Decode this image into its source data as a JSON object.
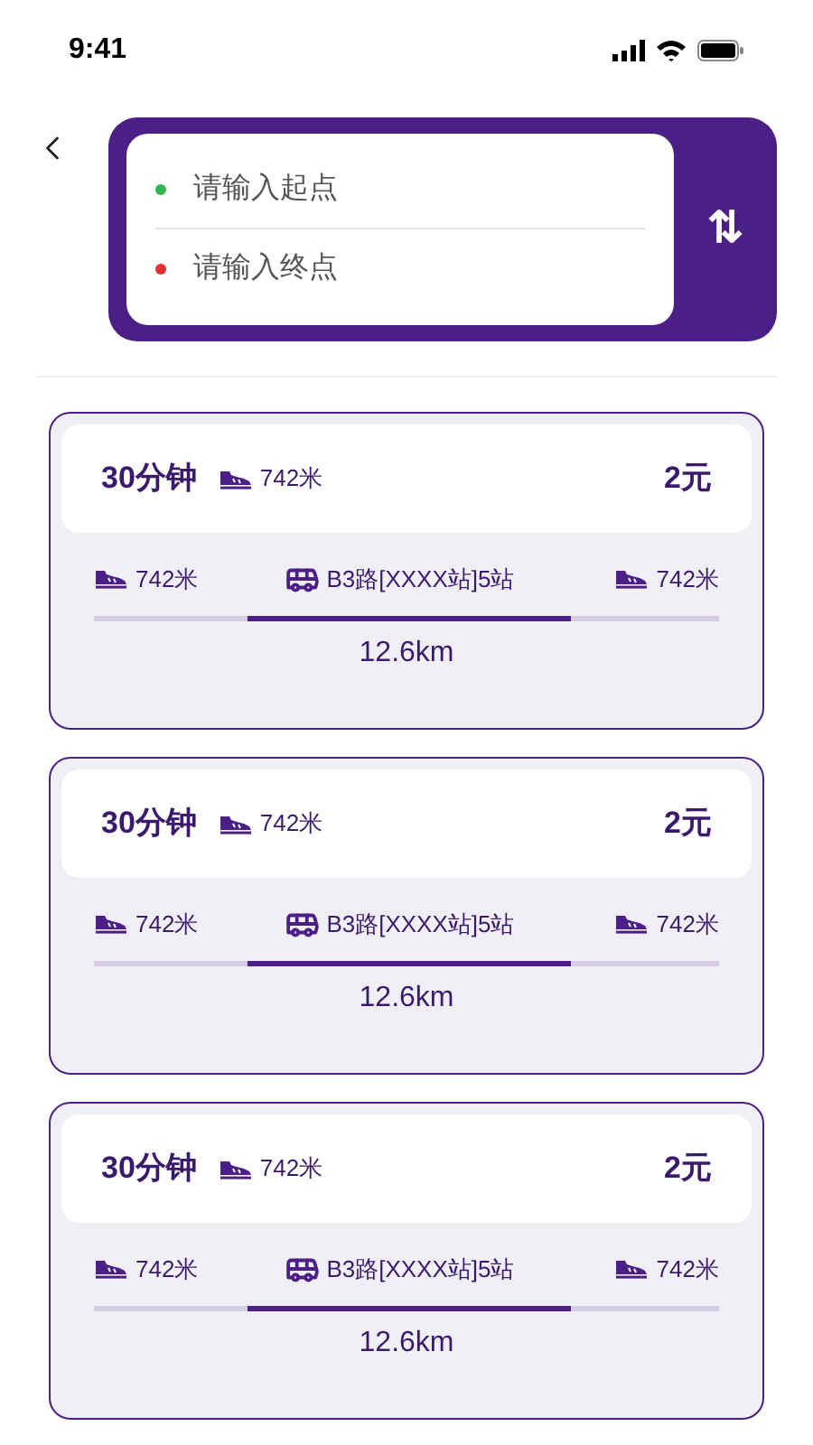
{
  "status_bar": {
    "time": "9:41"
  },
  "search": {
    "start": {
      "placeholder": "请输入起点",
      "color": "#2eb84f"
    },
    "end": {
      "placeholder": "请输入终点",
      "color": "#e53030"
    },
    "swap_icon": "⇅"
  },
  "routes": [
    {
      "duration": "30分钟",
      "walk_total": "742米",
      "price": "2元",
      "walk_start": "742米",
      "bus": "B3路[XXXX站]5站",
      "walk_end": "742米",
      "distance": "12.6km"
    },
    {
      "duration": "30分钟",
      "walk_total": "742米",
      "price": "2元",
      "walk_start": "742米",
      "bus": "B3路[XXXX站]5站",
      "walk_end": "742米",
      "distance": "12.6km"
    },
    {
      "duration": "30分钟",
      "walk_total": "742米",
      "price": "2元",
      "walk_start": "742米",
      "bus": "B3路[XXXX站]5站",
      "walk_end": "742米",
      "distance": "12.6km"
    }
  ]
}
